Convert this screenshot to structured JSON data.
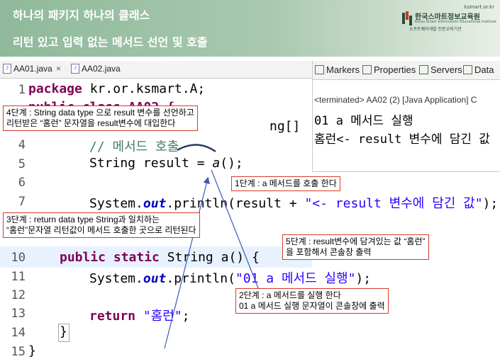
{
  "header": {
    "line1": "하나의 패키지 하나의 클래스",
    "line2": "리턴 있고 입력 없는 메서드 선언 및 호출",
    "logo_url": "ksmart.or.kr",
    "logo_name": "한국스마트정보교육원",
    "logo_sub": "Korea Smart Information Educational Institute",
    "logo_tagline": "소프트웨어개발 전문교육기관"
  },
  "editor": {
    "tabs": [
      {
        "label": "AA01.java",
        "icon": "java-file-icon"
      },
      {
        "label": "AA02.java",
        "icon": "java-file-icon"
      }
    ],
    "lines": [
      {
        "num": "1"
      },
      {
        "num": "4"
      },
      {
        "num": "5"
      },
      {
        "num": "6"
      },
      {
        "num": "7"
      },
      {
        "num": "10"
      },
      {
        "num": "11"
      },
      {
        "num": "12"
      },
      {
        "num": "13"
      },
      {
        "num": "14"
      },
      {
        "num": "15"
      }
    ],
    "code": {
      "l1_kw": "package",
      "l1_rest": " kr.or.ksmart.A;",
      "l2_partial": "public class AA02 {",
      "l3_tail": "ng[]",
      "l4": "// 메서드 호출",
      "l5_a": "String ",
      "l5_var": "result",
      "l5_b": " = ",
      "l5_call": "a",
      "l5_c": "();",
      "l7_a": "System.",
      "l7_out": "out",
      "l7_b": ".println(",
      "l7_var": "result",
      "l7_c": " + ",
      "l7_str": "\"<- result 변수에 담긴 값\"",
      "l7_d": ");",
      "l10_kw1": "public",
      "l10_kw2": "static",
      "l10_rest": " String a() {",
      "l11_a": "System.",
      "l11_out": "out",
      "l11_b": ".println(",
      "l11_str": "\"01 a 메서드 실행\"",
      "l11_c": ");",
      "l13_kw": "return",
      "l13_str": "\"홈런\"",
      "l13_c": ";",
      "l14": "}",
      "l15": "}"
    }
  },
  "console": {
    "tabs": [
      {
        "label": "Markers",
        "icon": "markers-icon"
      },
      {
        "label": "Properties",
        "icon": "properties-icon"
      },
      {
        "label": "Servers",
        "icon": "servers-icon"
      },
      {
        "label": "Data",
        "icon": "data-icon"
      }
    ],
    "terminated": "<terminated> AA02 (2) [Java Application] C",
    "output": [
      "01 a 메서드 실행",
      "홈런<- result 변수에 담긴 값"
    ]
  },
  "notes": {
    "step4_l1": "4단계 : String data type 으로 result 변수를 선언하고",
    "step4_l2": "리턴받은 “홈런” 문자열을 result변수에 대입한다",
    "step1": "1단계 : a 메서드를 호출 한다",
    "step3_l1": "3단계 : return data type String과 일치하는",
    "step3_l2": "“홈런”문자열 리턴값이 메서드 호출한 곳으로 리턴된다",
    "step5_l1": "5단계 : result변수에 담겨있는 값 “홈런”",
    "step5_l2": "을 포함해서 콘솔창 출력",
    "step2_l1": "2단계 : a 메서드를 실행 한다",
    "step2_l2": "01 a 메서드 실행 문자열이 콘솔창에 출력"
  },
  "colors": {
    "keyword": "#7f0055",
    "string": "#2a00ff",
    "comment": "#3f7f5f",
    "field": "#0000c0",
    "note_border": "#d63a2a",
    "arrow": "#3b5bb5",
    "header_bg": "#a9c9b0"
  }
}
